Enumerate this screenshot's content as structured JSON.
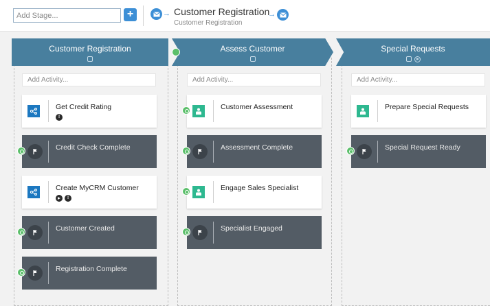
{
  "toolbar": {
    "add_stage_placeholder": "Add Stage...",
    "add_stage_button": "+",
    "case_title": "Customer Registration",
    "case_subtitle": "Customer Registration"
  },
  "stages": [
    {
      "title": "Customer Registration",
      "add_activity_placeholder": "Add Activity...",
      "cards": [
        {
          "type": "service",
          "label": "Get Credit Rating",
          "badges": [
            "warning"
          ]
        },
        {
          "type": "milestone",
          "label": "Credit Check Complete"
        },
        {
          "type": "service",
          "label": "Create MyCRM Customer",
          "badges": [
            "play",
            "warning"
          ]
        },
        {
          "type": "milestone",
          "label": "Customer Created"
        },
        {
          "type": "milestone",
          "label": "Registration Complete"
        }
      ]
    },
    {
      "title": "Assess Customer",
      "add_activity_placeholder": "Add Activity...",
      "cards": [
        {
          "type": "human",
          "label": "Customer Assessment"
        },
        {
          "type": "milestone",
          "label": "Assessment Complete"
        },
        {
          "type": "human",
          "label": "Engage Sales Specialist"
        },
        {
          "type": "milestone",
          "label": "Specialist Engaged"
        }
      ]
    },
    {
      "title": "Special Requests",
      "add_activity_placeholder": "Add Activity...",
      "cards": [
        {
          "type": "human",
          "label": "Prepare Special Requests"
        },
        {
          "type": "milestone",
          "label": "Special Request Ready"
        }
      ]
    }
  ],
  "colors": {
    "stage_header": "#487f9e",
    "milestone_card": "#535c65",
    "service_icon": "#1c78c0",
    "human_icon": "#2eb890",
    "entry_marker": "#5bbf6a",
    "accent": "#3d8fd6"
  },
  "icons": {
    "case_start": "envelope-icon",
    "case_end": "envelope-icon",
    "service_task": "service-task-icon",
    "human_task": "human-task-icon",
    "milestone": "flag-icon",
    "entry_criterion": "power-icon",
    "warning": "exclamation-icon",
    "play": "play-icon",
    "stage_options": "square-icon"
  }
}
